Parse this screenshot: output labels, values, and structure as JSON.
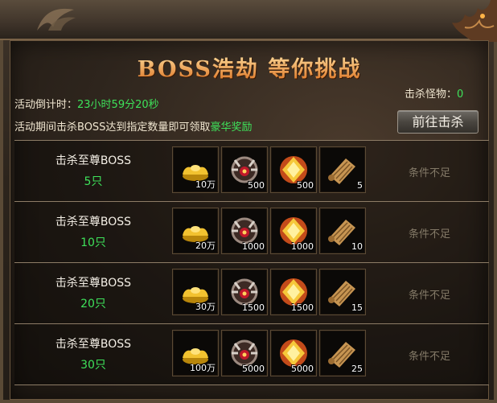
{
  "title": "BOSS浩劫  等你挑战",
  "countdown": {
    "label": "活动倒计时：",
    "value": "23小时59分20秒"
  },
  "kills": {
    "label": "击杀怪物：",
    "value": "0"
  },
  "info": {
    "text": "活动期间击杀BOSS达到指定数量即可领取",
    "highlight": "豪华奖励"
  },
  "goto_button": "前往击杀",
  "colors": {
    "accent_green": "#3ee25a",
    "title_gold": "#f3c27a",
    "status_gray": "#837967"
  },
  "tiers": [
    {
      "label": "击杀至尊BOSS",
      "count": "5只",
      "status": "条件不足",
      "rewards": [
        {
          "icon": "gold-ingot-icon",
          "qty": "10万"
        },
        {
          "icon": "demon-shield-icon",
          "qty": "500"
        },
        {
          "icon": "fire-gem-icon",
          "qty": "500"
        },
        {
          "icon": "scroll-icon",
          "qty": "5"
        }
      ]
    },
    {
      "label": "击杀至尊BOSS",
      "count": "10只",
      "status": "条件不足",
      "rewards": [
        {
          "icon": "gold-ingot-icon",
          "qty": "20万"
        },
        {
          "icon": "demon-shield-icon",
          "qty": "1000"
        },
        {
          "icon": "fire-gem-icon",
          "qty": "1000"
        },
        {
          "icon": "scroll-icon",
          "qty": "10"
        }
      ]
    },
    {
      "label": "击杀至尊BOSS",
      "count": "20只",
      "status": "条件不足",
      "rewards": [
        {
          "icon": "gold-ingot-icon",
          "qty": "30万"
        },
        {
          "icon": "demon-shield-icon",
          "qty": "1500"
        },
        {
          "icon": "fire-gem-icon",
          "qty": "1500"
        },
        {
          "icon": "scroll-icon",
          "qty": "15"
        }
      ]
    },
    {
      "label": "击杀至尊BOSS",
      "count": "30只",
      "status": "条件不足",
      "rewards": [
        {
          "icon": "gold-ingot-icon",
          "qty": "100万"
        },
        {
          "icon": "demon-shield-icon",
          "qty": "5000"
        },
        {
          "icon": "fire-gem-icon",
          "qty": "5000"
        },
        {
          "icon": "scroll-icon",
          "qty": "25"
        }
      ]
    }
  ]
}
